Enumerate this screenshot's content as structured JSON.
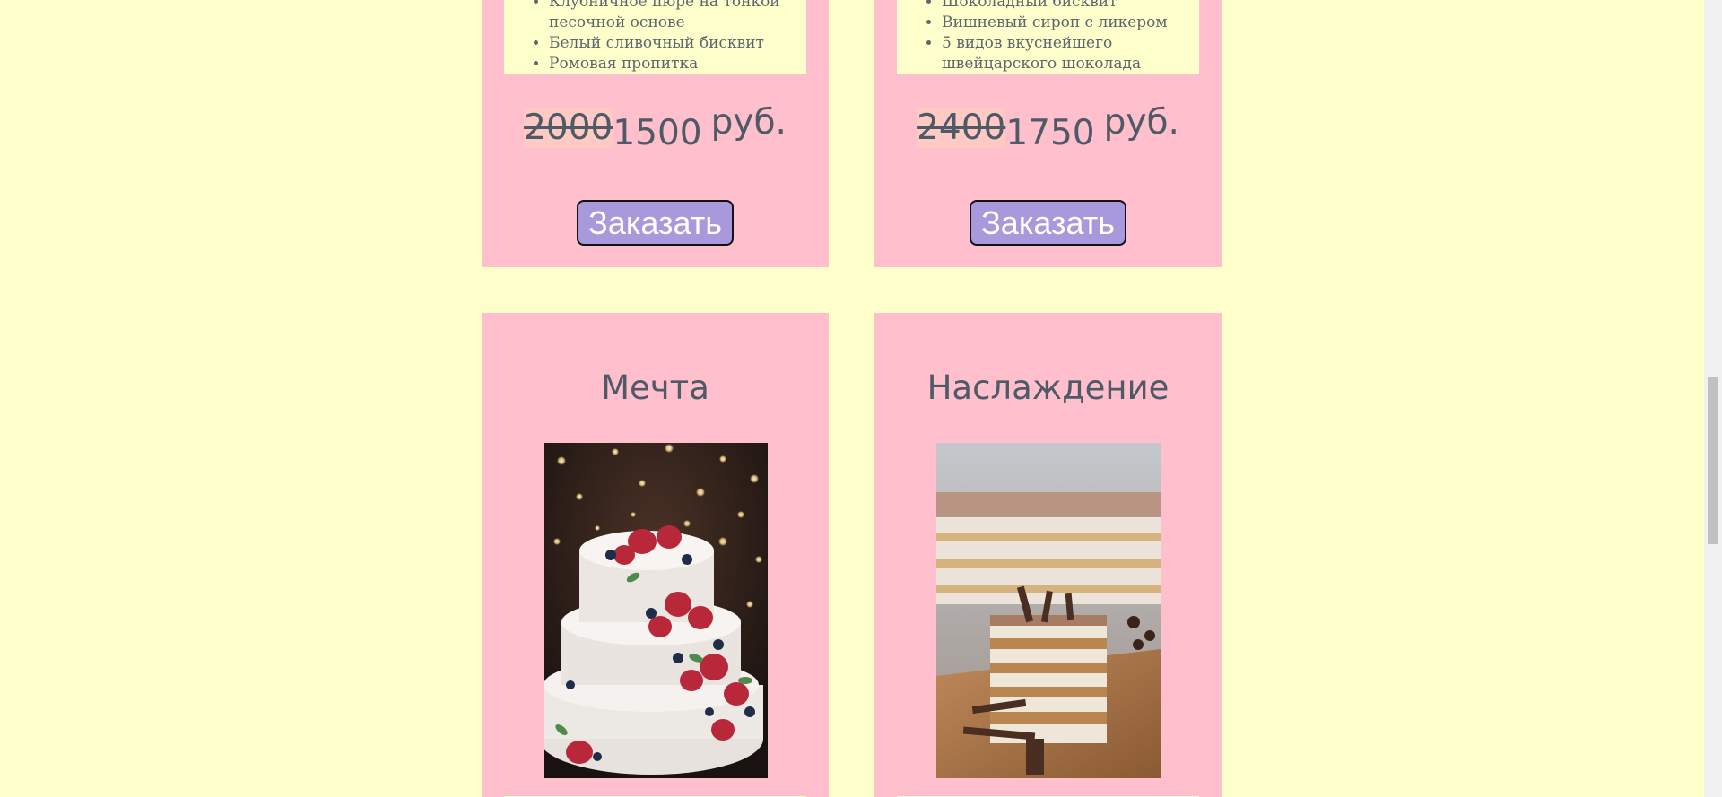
{
  "cards": [
    {
      "ingredients": [
        "Клубничное пюре на тонкой песочной основе",
        "Белый сливочный бисквит",
        "Ромовая пропитка"
      ],
      "old_price": "2000",
      "new_price": "1500",
      "currency": "руб.",
      "button_label": "Заказать"
    },
    {
      "ingredients": [
        "Шоколадный бисквит",
        "Вишневый сироп с ликером",
        "5 видов вкуснейшего швейцарского шоколада"
      ],
      "old_price": "2400",
      "new_price": "1750",
      "currency": "руб.",
      "button_label": "Заказать"
    },
    {
      "title": "Мечта",
      "image": "strawberry-berry-tiered-cake"
    },
    {
      "title": "Наслаждение",
      "image": "tiramisu-cake-slice"
    }
  ],
  "colors": {
    "page_background": "#ffffcc",
    "card_background": "#ffbfcc",
    "button_background": "#a898dc",
    "text": "#4e5a66"
  }
}
